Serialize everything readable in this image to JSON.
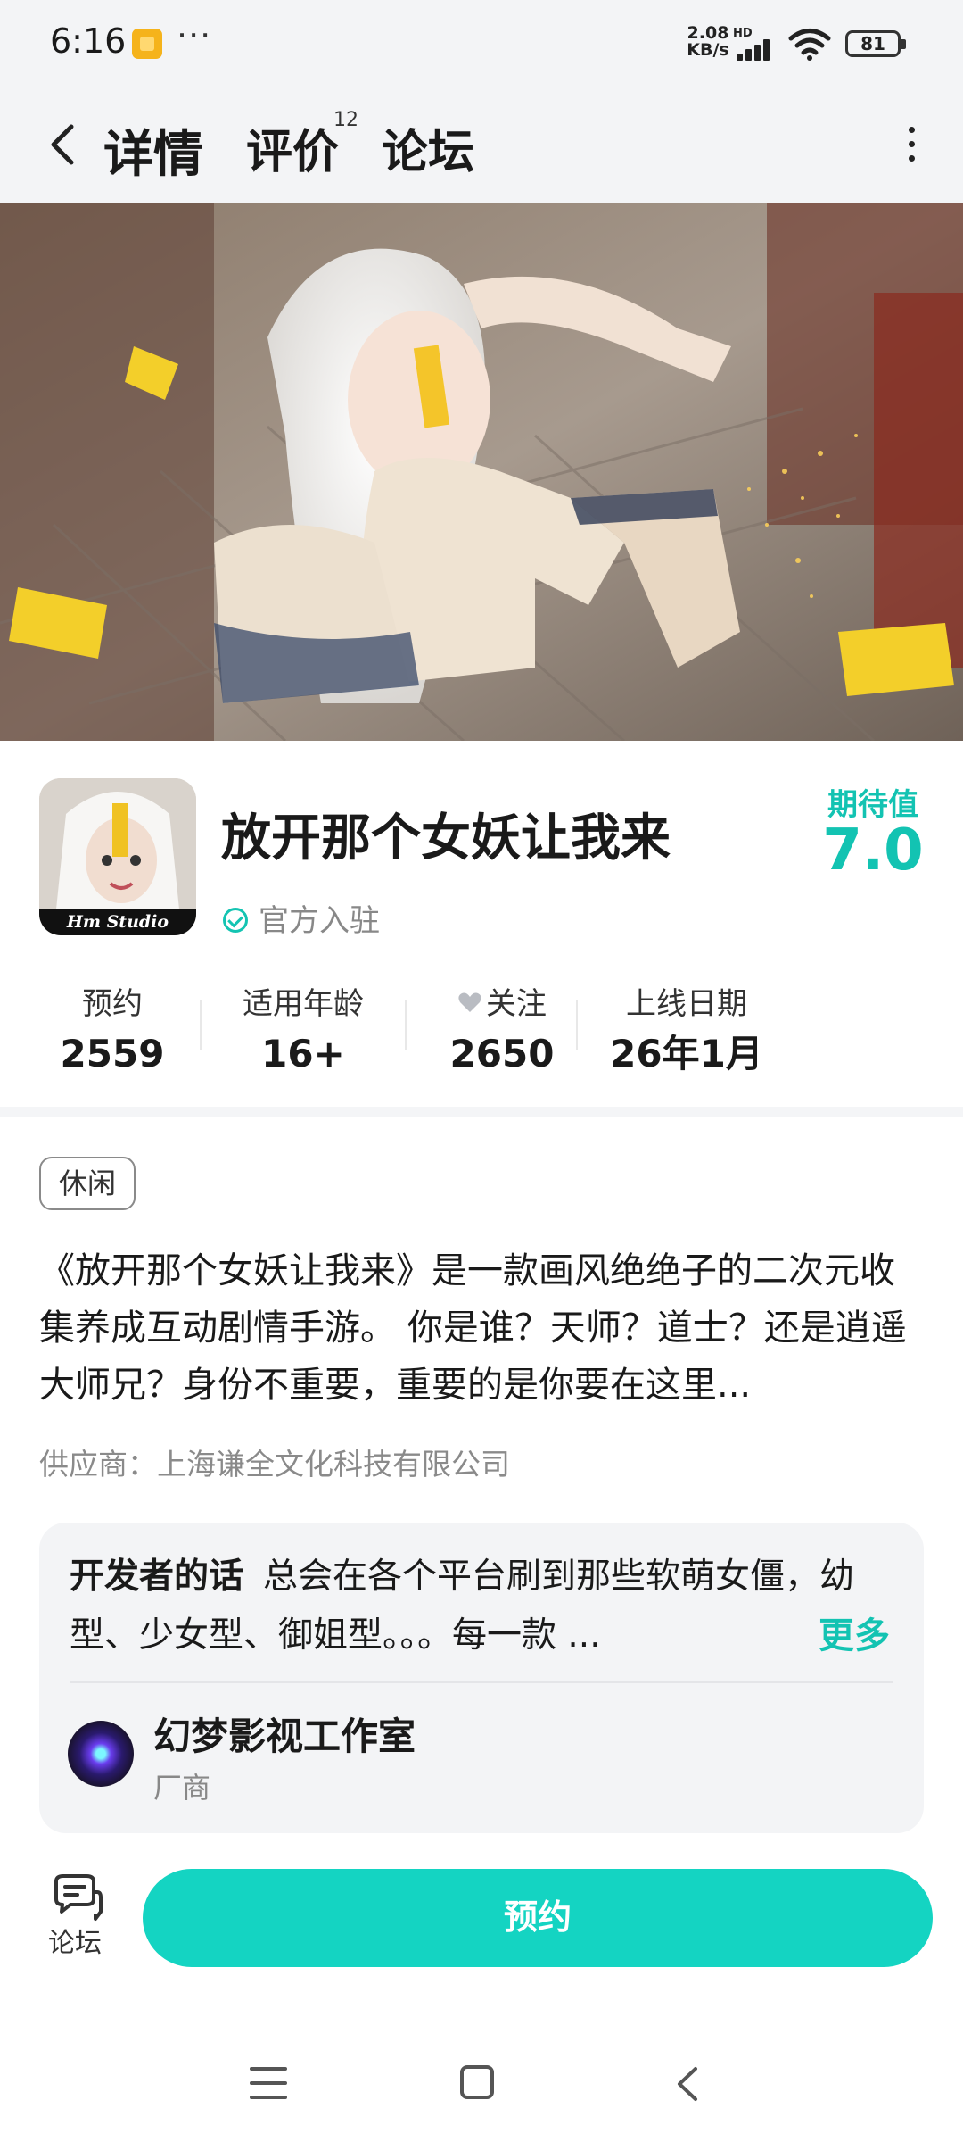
{
  "status_bar": {
    "time": "6:16",
    "more": "···",
    "net_speed": "2.08",
    "net_unit": "KB/s",
    "hd": "HD",
    "battery": "81"
  },
  "nav": {
    "tabs": [
      {
        "label": "详情",
        "active": true
      },
      {
        "label": "评价",
        "badge": "12"
      },
      {
        "label": "论坛"
      }
    ]
  },
  "game": {
    "icon_caption": "Hm Studio",
    "title": "放开那个女妖让我来",
    "official_label": "官方入驻",
    "expect_label": "期待值",
    "expect_value": "7.0"
  },
  "stats": [
    {
      "label": "预约",
      "value": "2559"
    },
    {
      "label": "适用年龄",
      "value": "16+"
    },
    {
      "label": "关注",
      "value": "2650"
    },
    {
      "label": "上线日期",
      "value": "26年1月"
    }
  ],
  "tag": "休闲",
  "description": "《放开那个女妖让我来》是一款画风绝绝子的二次元收集养成互动剧情手游。 你是谁？天师？道士？还是逍遥大师兄？身份不重要，重要的是你要在这里...",
  "supplier": "供应商：上海谦全文化科技有限公司",
  "developer": {
    "heading": "开发者的话",
    "text": "总会在各个平台刷到那些软萌女僵，幼型、少女型、御姐型。。。每一款 ...",
    "more": "更多",
    "name": "幻梦影视工作室",
    "role": "厂商"
  },
  "bottom": {
    "forum_label": "论坛",
    "reserve_label": "预约"
  },
  "colors": {
    "accent": "#14d4c2",
    "accent_text": "#13c3b2",
    "card_bg": "#f3f4f6"
  }
}
